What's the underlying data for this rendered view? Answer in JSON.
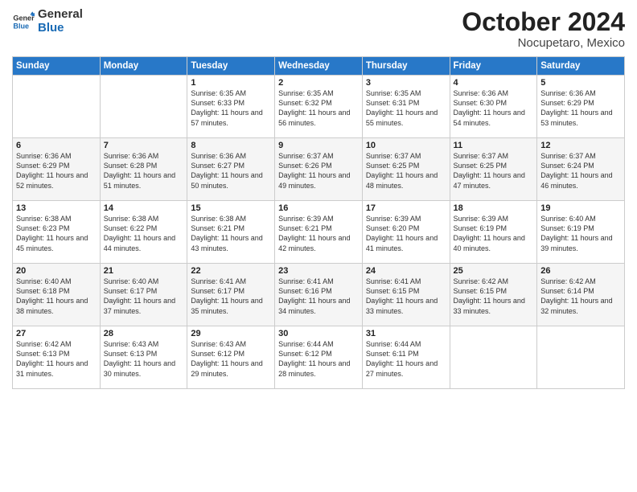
{
  "header": {
    "logo_general": "General",
    "logo_blue": "Blue",
    "month_title": "October 2024",
    "location": "Nocupetaro, Mexico"
  },
  "days_of_week": [
    "Sunday",
    "Monday",
    "Tuesday",
    "Wednesday",
    "Thursday",
    "Friday",
    "Saturday"
  ],
  "weeks": [
    [
      {
        "day": "",
        "info": ""
      },
      {
        "day": "",
        "info": ""
      },
      {
        "day": "1",
        "info": "Sunrise: 6:35 AM\nSunset: 6:33 PM\nDaylight: 11 hours and 57 minutes."
      },
      {
        "day": "2",
        "info": "Sunrise: 6:35 AM\nSunset: 6:32 PM\nDaylight: 11 hours and 56 minutes."
      },
      {
        "day": "3",
        "info": "Sunrise: 6:35 AM\nSunset: 6:31 PM\nDaylight: 11 hours and 55 minutes."
      },
      {
        "day": "4",
        "info": "Sunrise: 6:36 AM\nSunset: 6:30 PM\nDaylight: 11 hours and 54 minutes."
      },
      {
        "day": "5",
        "info": "Sunrise: 6:36 AM\nSunset: 6:29 PM\nDaylight: 11 hours and 53 minutes."
      }
    ],
    [
      {
        "day": "6",
        "info": "Sunrise: 6:36 AM\nSunset: 6:29 PM\nDaylight: 11 hours and 52 minutes."
      },
      {
        "day": "7",
        "info": "Sunrise: 6:36 AM\nSunset: 6:28 PM\nDaylight: 11 hours and 51 minutes."
      },
      {
        "day": "8",
        "info": "Sunrise: 6:36 AM\nSunset: 6:27 PM\nDaylight: 11 hours and 50 minutes."
      },
      {
        "day": "9",
        "info": "Sunrise: 6:37 AM\nSunset: 6:26 PM\nDaylight: 11 hours and 49 minutes."
      },
      {
        "day": "10",
        "info": "Sunrise: 6:37 AM\nSunset: 6:25 PM\nDaylight: 11 hours and 48 minutes."
      },
      {
        "day": "11",
        "info": "Sunrise: 6:37 AM\nSunset: 6:25 PM\nDaylight: 11 hours and 47 minutes."
      },
      {
        "day": "12",
        "info": "Sunrise: 6:37 AM\nSunset: 6:24 PM\nDaylight: 11 hours and 46 minutes."
      }
    ],
    [
      {
        "day": "13",
        "info": "Sunrise: 6:38 AM\nSunset: 6:23 PM\nDaylight: 11 hours and 45 minutes."
      },
      {
        "day": "14",
        "info": "Sunrise: 6:38 AM\nSunset: 6:22 PM\nDaylight: 11 hours and 44 minutes."
      },
      {
        "day": "15",
        "info": "Sunrise: 6:38 AM\nSunset: 6:21 PM\nDaylight: 11 hours and 43 minutes."
      },
      {
        "day": "16",
        "info": "Sunrise: 6:39 AM\nSunset: 6:21 PM\nDaylight: 11 hours and 42 minutes."
      },
      {
        "day": "17",
        "info": "Sunrise: 6:39 AM\nSunset: 6:20 PM\nDaylight: 11 hours and 41 minutes."
      },
      {
        "day": "18",
        "info": "Sunrise: 6:39 AM\nSunset: 6:19 PM\nDaylight: 11 hours and 40 minutes."
      },
      {
        "day": "19",
        "info": "Sunrise: 6:40 AM\nSunset: 6:19 PM\nDaylight: 11 hours and 39 minutes."
      }
    ],
    [
      {
        "day": "20",
        "info": "Sunrise: 6:40 AM\nSunset: 6:18 PM\nDaylight: 11 hours and 38 minutes."
      },
      {
        "day": "21",
        "info": "Sunrise: 6:40 AM\nSunset: 6:17 PM\nDaylight: 11 hours and 37 minutes."
      },
      {
        "day": "22",
        "info": "Sunrise: 6:41 AM\nSunset: 6:17 PM\nDaylight: 11 hours and 35 minutes."
      },
      {
        "day": "23",
        "info": "Sunrise: 6:41 AM\nSunset: 6:16 PM\nDaylight: 11 hours and 34 minutes."
      },
      {
        "day": "24",
        "info": "Sunrise: 6:41 AM\nSunset: 6:15 PM\nDaylight: 11 hours and 33 minutes."
      },
      {
        "day": "25",
        "info": "Sunrise: 6:42 AM\nSunset: 6:15 PM\nDaylight: 11 hours and 33 minutes."
      },
      {
        "day": "26",
        "info": "Sunrise: 6:42 AM\nSunset: 6:14 PM\nDaylight: 11 hours and 32 minutes."
      }
    ],
    [
      {
        "day": "27",
        "info": "Sunrise: 6:42 AM\nSunset: 6:13 PM\nDaylight: 11 hours and 31 minutes."
      },
      {
        "day": "28",
        "info": "Sunrise: 6:43 AM\nSunset: 6:13 PM\nDaylight: 11 hours and 30 minutes."
      },
      {
        "day": "29",
        "info": "Sunrise: 6:43 AM\nSunset: 6:12 PM\nDaylight: 11 hours and 29 minutes."
      },
      {
        "day": "30",
        "info": "Sunrise: 6:44 AM\nSunset: 6:12 PM\nDaylight: 11 hours and 28 minutes."
      },
      {
        "day": "31",
        "info": "Sunrise: 6:44 AM\nSunset: 6:11 PM\nDaylight: 11 hours and 27 minutes."
      },
      {
        "day": "",
        "info": ""
      },
      {
        "day": "",
        "info": ""
      }
    ]
  ]
}
